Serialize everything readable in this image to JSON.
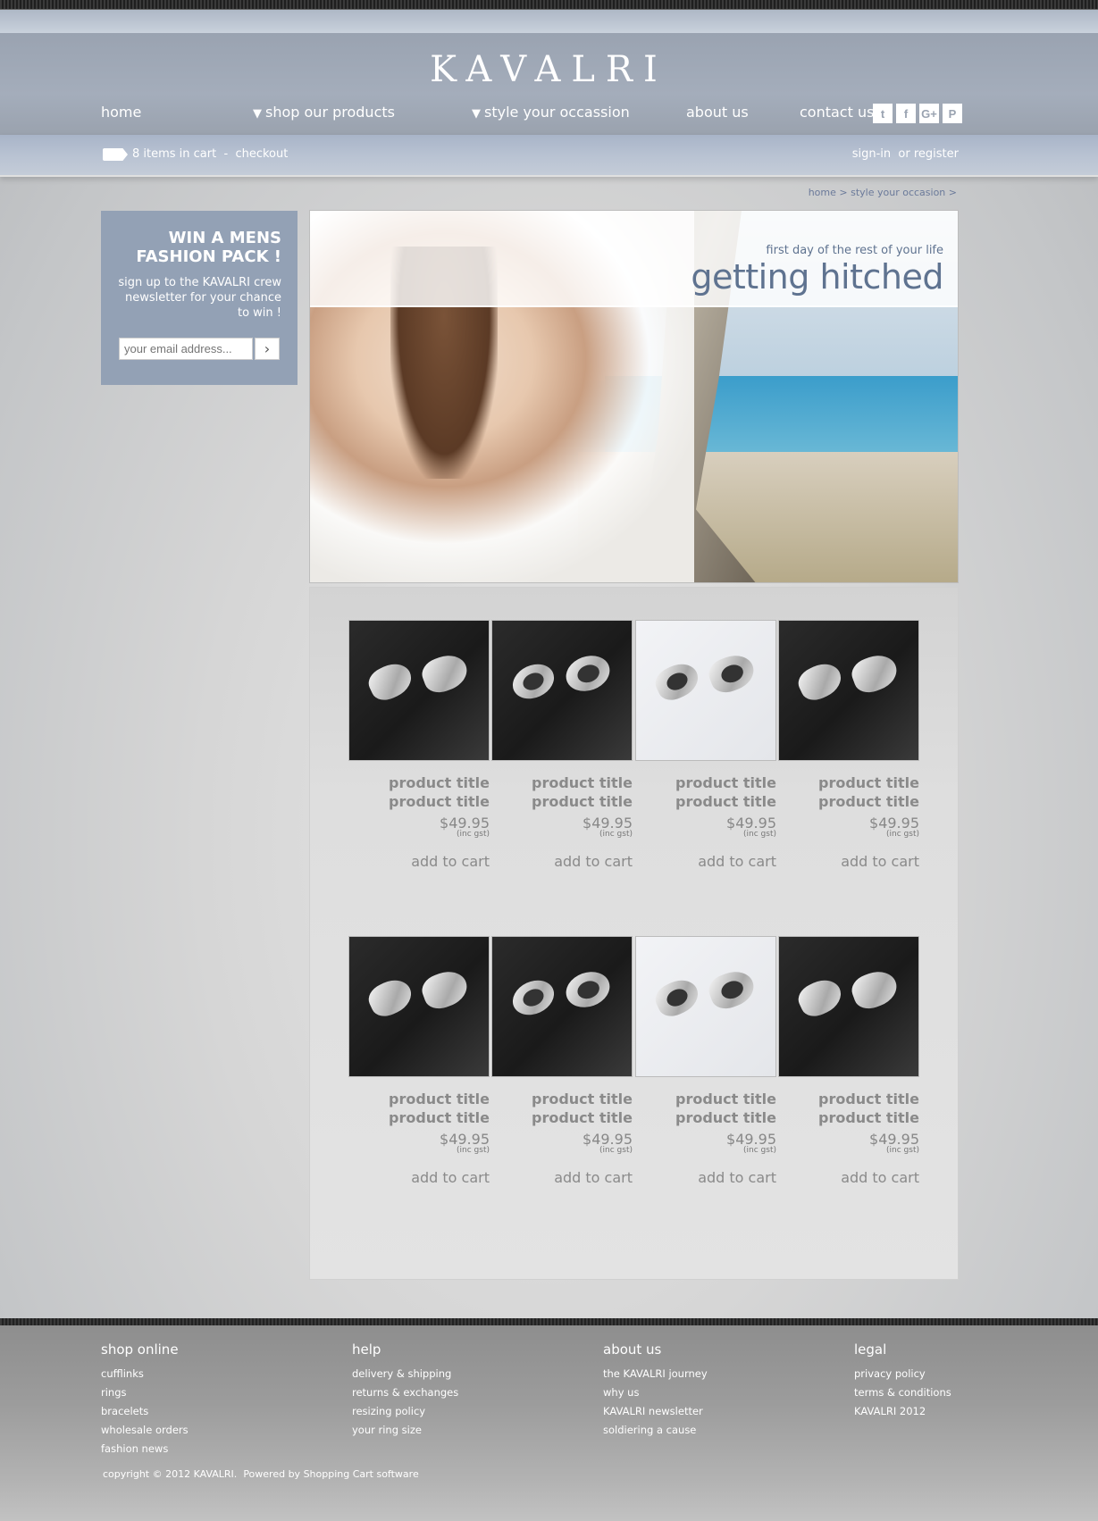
{
  "brand": {
    "logo": "KAVALRI"
  },
  "nav": {
    "home": "home",
    "shop": "shop our products",
    "style": "style your occassion",
    "about": "about us",
    "contact": "contact us",
    "arrow": "▼"
  },
  "social": {
    "twitter": "t",
    "facebook": "f",
    "googleplus": "G+",
    "pinterest": "P"
  },
  "cart": {
    "items": "8 items in cart",
    "separator": "-",
    "checkout": "checkout",
    "signin": "sign-in",
    "register": "or register"
  },
  "breadcrumb": {
    "home": "home",
    "sep1": ">",
    "current": "style your occasion",
    "sep2": ">"
  },
  "newsletter": {
    "title_line1": "WIN A MENS",
    "title_line2": "FASHION PACK !",
    "text": "sign up to the KAVALRI crew newsletter for your chance to win !",
    "placeholder": "your email address...",
    "submit_icon": "chevron-right-icon"
  },
  "hero": {
    "subtitle": "first day of the rest of your life",
    "title": "getting hitched"
  },
  "products": [
    {
      "title1": "product title",
      "title2": "product title",
      "price": "$49.95",
      "gst": "(inc gst)",
      "cart": "add to cart",
      "style": "dark-curve"
    },
    {
      "title1": "product title",
      "title2": "product title",
      "price": "$49.95",
      "gst": "(inc gst)",
      "cart": "add to cart",
      "style": "dark-round"
    },
    {
      "title1": "product title",
      "title2": "product title",
      "price": "$49.95",
      "gst": "(inc gst)",
      "cart": "add to cart",
      "style": "light-oval"
    },
    {
      "title1": "product title",
      "title2": "product title",
      "price": "$49.95",
      "gst": "(inc gst)",
      "cart": "add to cart",
      "style": "dark-moustache"
    },
    {
      "title1": "product title",
      "title2": "product title",
      "price": "$49.95",
      "gst": "(inc gst)",
      "cart": "add to cart",
      "style": "dark-curve"
    },
    {
      "title1": "product title",
      "title2": "product title",
      "price": "$49.95",
      "gst": "(inc gst)",
      "cart": "add to cart",
      "style": "dark-round"
    },
    {
      "title1": "product title",
      "title2": "product title",
      "price": "$49.95",
      "gst": "(inc gst)",
      "cart": "add to cart",
      "style": "light-oval"
    },
    {
      "title1": "product title",
      "title2": "product title",
      "price": "$49.95",
      "gst": "(inc gst)",
      "cart": "add to cart",
      "style": "dark-moustache"
    }
  ],
  "footer": {
    "shop": {
      "heading": "shop online",
      "links": [
        "cufflinks",
        "rings",
        "bracelets",
        "wholesale orders",
        "fashion news"
      ]
    },
    "help": {
      "heading": "help",
      "links": [
        "delivery & shipping",
        "returns & exchanges",
        "resizing policy",
        "your ring size"
      ]
    },
    "about": {
      "heading": "about us",
      "links": [
        "the KAVALRI journey",
        "why us",
        "KAVALRI newsletter",
        "soldiering a cause"
      ]
    },
    "legal": {
      "heading": "legal",
      "links": [
        "privacy policy",
        "terms & conditions",
        "KAVALRI 2012"
      ]
    },
    "copyright": "copyright © 2012 KAVALRI.",
    "powered": "Powered by Shopping Cart software"
  }
}
